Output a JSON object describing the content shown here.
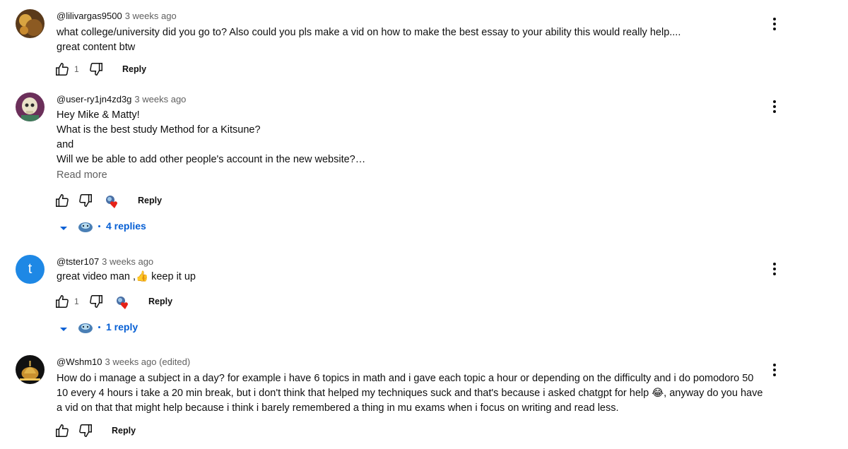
{
  "comments": [
    {
      "handle": "@lilivargas9500",
      "time": "3 weeks ago",
      "lines": [
        "what college/university did you go to? Also could you pls make a vid on how to make the best essay to your ability this would really help....",
        "great content btw"
      ],
      "like_count": "1",
      "reply_label": "Reply"
    },
    {
      "handle": "@user-ry1jn4zd3g",
      "time": "3 weeks ago",
      "lines": [
        "Hey Mike & Matty!",
        "What is the best study Method for a Kitsune?",
        "and",
        "Will we be able to add other people's account in the new website?…"
      ],
      "read_more": "Read more",
      "reply_label": "Reply",
      "replies_label": "4 replies"
    },
    {
      "handle": "@tster107",
      "time": "3 weeks ago",
      "avatar_letter": "t",
      "lines": [
        "great video man ,👍 keep it up"
      ],
      "like_count": "1",
      "reply_label": "Reply",
      "replies_label": "1 reply"
    },
    {
      "handle": "@Wshm10",
      "time": "3 weeks ago (edited)",
      "lines": [
        "How do i manage a subject in a day? for example i have 6 topics in math and i gave each topic a hour or depending on the difficulty and i do pomodoro 50",
        "10 every 4 hours i take a 20 min break, but i don't think that helped my techniques suck and that's because i asked chatgpt for help 😂, anyway do you have",
        "a vid on that that might help because i think i barely remembered a thing in mu exams when i focus on writing and read less."
      ],
      "reply_label": "Reply"
    }
  ],
  "colors": {
    "link_blue": "#065fd4",
    "secondary_text": "#606060",
    "avatar_blue": "#1e88e5",
    "heart_red": "#e62117"
  },
  "icons": [
    "thumb-up-icon",
    "thumb-down-icon",
    "more-vert-icon",
    "caret-down-icon",
    "creator-heart-icon"
  ]
}
